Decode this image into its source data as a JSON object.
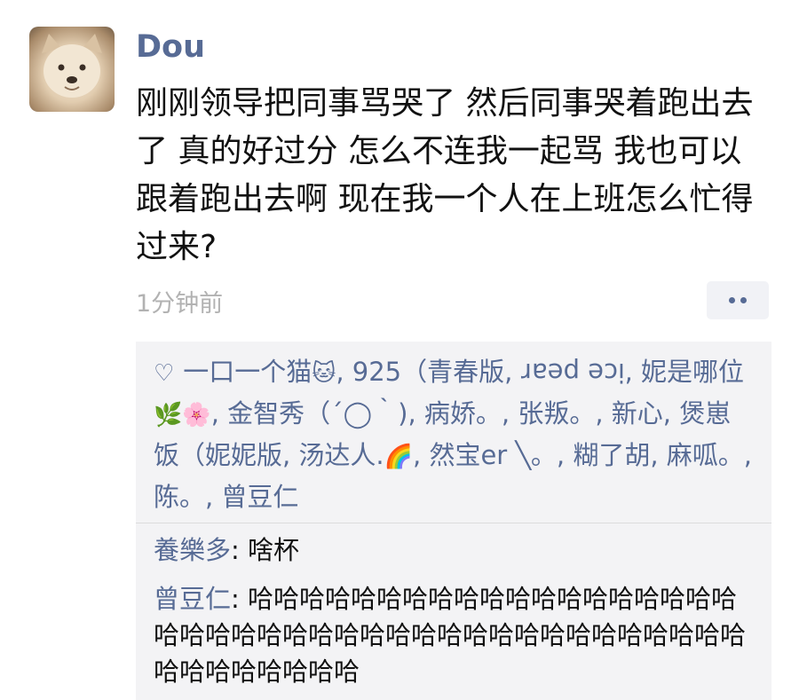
{
  "author": "Dou",
  "post_text": "刚刚领导把同事骂哭了 然后同事哭着跑出去了 真的好过分 怎么不连我一起骂 我也可以跟着跑出去啊 现在我一个人在上班怎么忙得过来?",
  "time": "1分钟前",
  "likes": {
    "icon": "heart-outline-icon",
    "seg1": "一口一个猫",
    "seg2": ", 925（青春版, ",
    "seg_upside": "ice pear",
    "seg3": ", 妮是哪位",
    "seg4": ", 金智秀（´◯｀), 病娇。, 张叛。, 新心, 煲崽饭（妮妮版, 汤达人.",
    "seg5": ", 然宝er ╲。, 糊了胡, 麻呱。, 陈。, 曾豆仁"
  },
  "comments": [
    {
      "name": "養樂多",
      "text": ": 啥杯"
    },
    {
      "name": "曾豆仁",
      "text": ": 哈哈哈哈哈哈哈哈哈哈哈哈哈哈哈哈哈哈哈哈哈哈哈哈哈哈哈哈哈哈哈哈哈哈哈哈哈哈哈哈哈哈哈哈哈哈哈哈哈哈"
    }
  ]
}
